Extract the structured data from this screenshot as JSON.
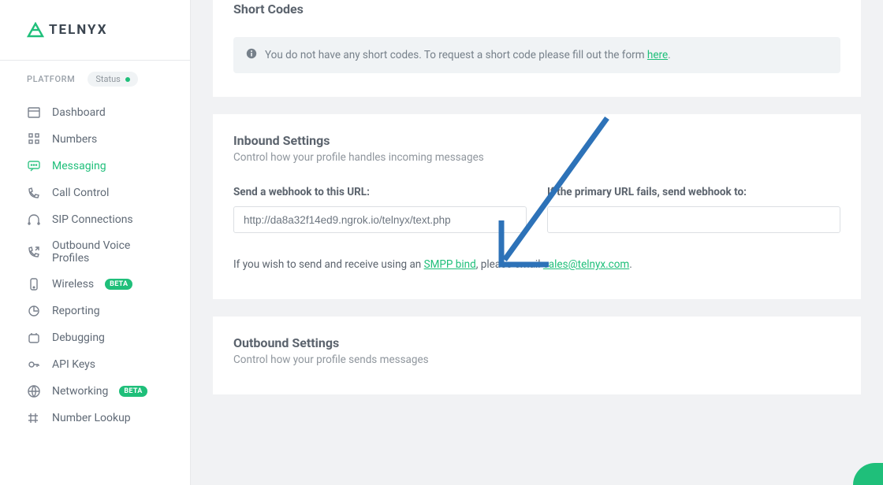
{
  "brand": {
    "name": "TELNYX"
  },
  "sidebar": {
    "platform_label": "PLATFORM",
    "status_label": "Status",
    "items": [
      {
        "label": "Dashboard",
        "icon": "dashboard-icon",
        "badge": null
      },
      {
        "label": "Numbers",
        "icon": "numbers-icon",
        "badge": null
      },
      {
        "label": "Messaging",
        "icon": "messaging-icon",
        "badge": null,
        "active": true
      },
      {
        "label": "Call Control",
        "icon": "call-control-icon",
        "badge": null
      },
      {
        "label": "SIP Connections",
        "icon": "sip-icon",
        "badge": null
      },
      {
        "label": "Outbound Voice Profiles",
        "icon": "outbound-icon",
        "badge": null
      },
      {
        "label": "Wireless",
        "icon": "wireless-icon",
        "badge": "BETA"
      },
      {
        "label": "Reporting",
        "icon": "reporting-icon",
        "badge": null
      },
      {
        "label": "Debugging",
        "icon": "debugging-icon",
        "badge": null
      },
      {
        "label": "API Keys",
        "icon": "api-keys-icon",
        "badge": null
      },
      {
        "label": "Networking",
        "icon": "networking-icon",
        "badge": "BETA"
      },
      {
        "label": "Number Lookup",
        "icon": "number-lookup-icon",
        "badge": null
      }
    ]
  },
  "short_codes": {
    "title": "Short Codes",
    "alert_text": "You do not have any short codes. To request a short code please fill out the form ",
    "alert_link": "here",
    "alert_suffix": "."
  },
  "inbound": {
    "title": "Inbound Settings",
    "subtitle": "Control how your profile handles incoming messages",
    "webhook_label": "Send a webhook to this URL:",
    "webhook_value": "http://da8a32f14ed9.ngrok.io/telnyx/text.php",
    "failover_label": "If the primary URL fails, send webhook to:",
    "failover_value": "",
    "helper_prefix": "If you wish to send and receive using an ",
    "helper_link1": "SMPP bind",
    "helper_mid": ", please email ",
    "helper_link2": "sales@telnyx.com",
    "helper_suffix": "."
  },
  "outbound": {
    "title": "Outbound Settings",
    "subtitle": "Control how your profile sends messages"
  }
}
